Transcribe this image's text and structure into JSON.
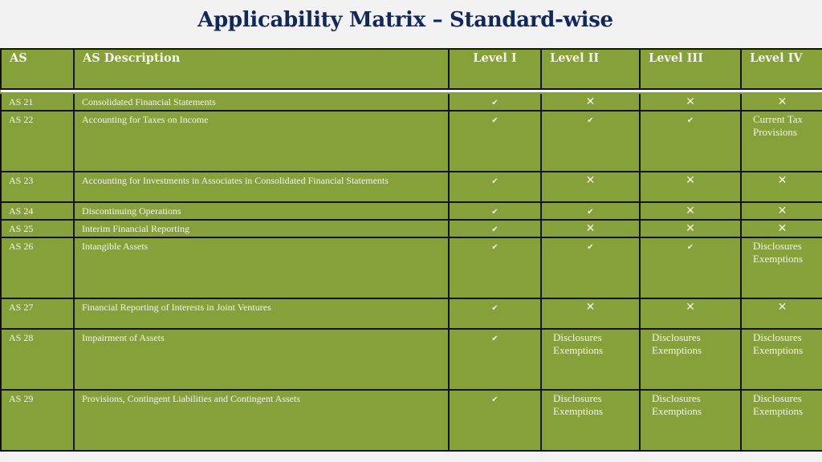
{
  "title": "Applicability Matrix – Standard-wise",
  "table": {
    "headers": [
      "AS",
      "AS Description",
      "Level I",
      "Level II",
      "Level III",
      "Level IV"
    ],
    "rows": [
      {
        "as": "AS 21",
        "description": "Consolidated Financial Statements",
        "levels": [
          "✔",
          "✕",
          "✕",
          "✕"
        ]
      },
      {
        "as": "AS 22",
        "description": "Accounting for Taxes on Income",
        "levels": [
          "✔",
          "✔",
          "✔",
          "Current Tax Provisions"
        ]
      },
      {
        "as": "AS 23",
        "description": "Accounting for Investments in Associates in Consolidated Financial Statements",
        "levels": [
          "✔",
          "✕",
          "✕",
          "✕"
        ]
      },
      {
        "as": "AS 24",
        "description": "Discontinuing Operations",
        "levels": [
          "✔",
          "✔",
          "✕",
          "✕"
        ]
      },
      {
        "as": "AS 25",
        "description": "Interim Financial Reporting",
        "levels": [
          "✔",
          "✕",
          "✕",
          "✕"
        ]
      },
      {
        "as": "AS 26",
        "description": "Intangible Assets",
        "levels": [
          "✔",
          "✔",
          "✔",
          "Disclosures Exemptions"
        ]
      },
      {
        "as": "AS 27",
        "description": "Financial Reporting of Interests in Joint Ventures",
        "levels": [
          "✔",
          "✕",
          "✕",
          "✕"
        ]
      },
      {
        "as": "AS 28",
        "description": "Impairment of Assets",
        "levels": [
          "✔",
          "Disclosures Exemptions",
          "Disclosures Exemptions",
          "Disclosures Exemptions"
        ]
      },
      {
        "as": "AS 29",
        "description": "Provisions, Contingent Liabilities and Contingent Assets",
        "levels": [
          "✔",
          "Disclosures Exemptions",
          "Disclosures Exemptions",
          "Disclosures Exemptions"
        ]
      }
    ]
  },
  "colors": {
    "title": "#11285b",
    "table_bg": "#87a13a",
    "text": "#f4f4ea"
  }
}
